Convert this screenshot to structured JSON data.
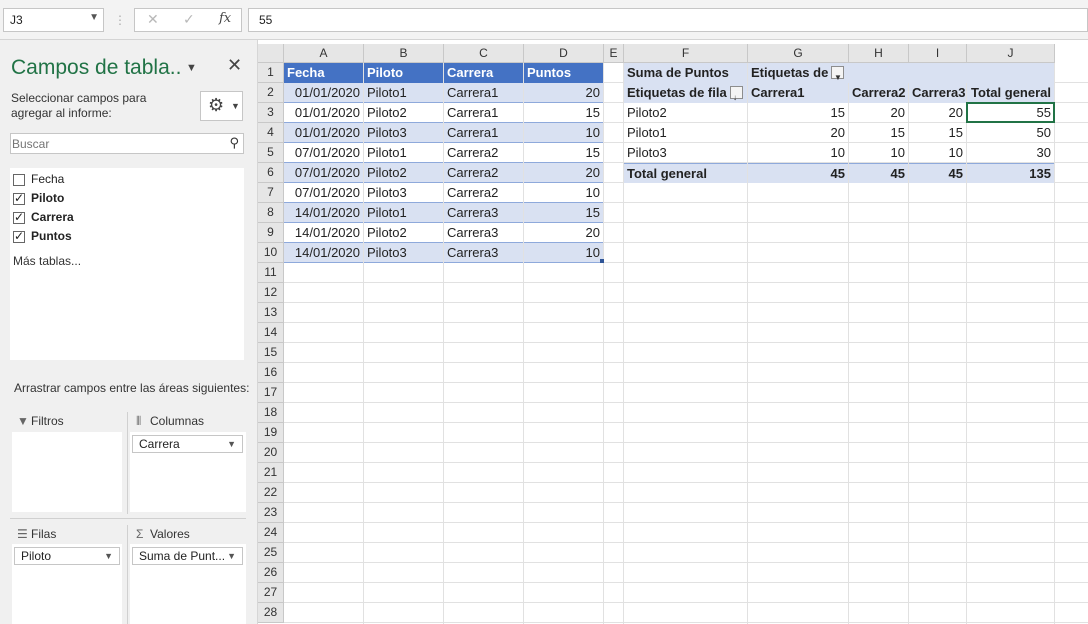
{
  "formula_bar": {
    "name_box": "J3",
    "formula": "55",
    "cancel_icon": "✕",
    "enter_icon": "✓",
    "fx_label": "fx"
  },
  "pane": {
    "title": "Campos de tabla..",
    "description": "Seleccionar campos para agregar al informe:",
    "search_placeholder": "Buscar",
    "fields": [
      {
        "label": "Fecha",
        "checked": false
      },
      {
        "label": "Piloto",
        "checked": true
      },
      {
        "label": "Carrera",
        "checked": true
      },
      {
        "label": "Puntos",
        "checked": true
      }
    ],
    "more_tables": "Más tablas...",
    "drag_hint": "Arrastrar campos entre las áreas siguientes:",
    "areas": {
      "filters": {
        "label": "Filtros"
      },
      "columns": {
        "label": "Columnas",
        "chip": "Carrera"
      },
      "rows": {
        "label": "Filas",
        "chip": "Piloto"
      },
      "values": {
        "label": "Valores",
        "chip": "Suma de Punt..."
      }
    }
  },
  "sheet": {
    "columns": [
      "A",
      "B",
      "C",
      "D",
      "E",
      "F",
      "G",
      "H",
      "I",
      "J"
    ],
    "rows": [
      "1",
      "2",
      "3",
      "4",
      "5",
      "6",
      "7",
      "8",
      "9",
      "10",
      "11",
      "12",
      "13",
      "14",
      "15",
      "16",
      "17",
      "18",
      "19",
      "20",
      "21",
      "22",
      "23",
      "24",
      "25",
      "26",
      "27",
      "28"
    ],
    "table": {
      "headers": [
        "Fecha",
        "Piloto",
        "Carrera",
        "Puntos"
      ],
      "rows": [
        [
          "01/01/2020",
          "Piloto1",
          "Carrera1",
          "20"
        ],
        [
          "01/01/2020",
          "Piloto2",
          "Carrera1",
          "15"
        ],
        [
          "01/01/2020",
          "Piloto3",
          "Carrera1",
          "10"
        ],
        [
          "07/01/2020",
          "Piloto1",
          "Carrera2",
          "15"
        ],
        [
          "07/01/2020",
          "Piloto2",
          "Carrera2",
          "20"
        ],
        [
          "07/01/2020",
          "Piloto3",
          "Carrera2",
          "10"
        ],
        [
          "14/01/2020",
          "Piloto1",
          "Carrera3",
          "15"
        ],
        [
          "14/01/2020",
          "Piloto2",
          "Carrera3",
          "20"
        ],
        [
          "14/01/2020",
          "Piloto3",
          "Carrera3",
          "10"
        ]
      ]
    },
    "pivot": {
      "sum_label": "Suma de Puntos",
      "col_labels": "Etiquetas de columna",
      "row_labels": "Etiquetas de fila",
      "col_headers": [
        "Carrera1",
        "Carrera2",
        "Carrera3",
        "Total general"
      ],
      "rows": [
        {
          "label": "Piloto2",
          "values": [
            "15",
            "20",
            "20",
            "55"
          ]
        },
        {
          "label": "Piloto1",
          "values": [
            "20",
            "15",
            "15",
            "50"
          ]
        },
        {
          "label": "Piloto3",
          "values": [
            "10",
            "10",
            "10",
            "30"
          ]
        }
      ],
      "total": {
        "label": "Total general",
        "values": [
          "45",
          "45",
          "45",
          "135"
        ]
      }
    }
  }
}
